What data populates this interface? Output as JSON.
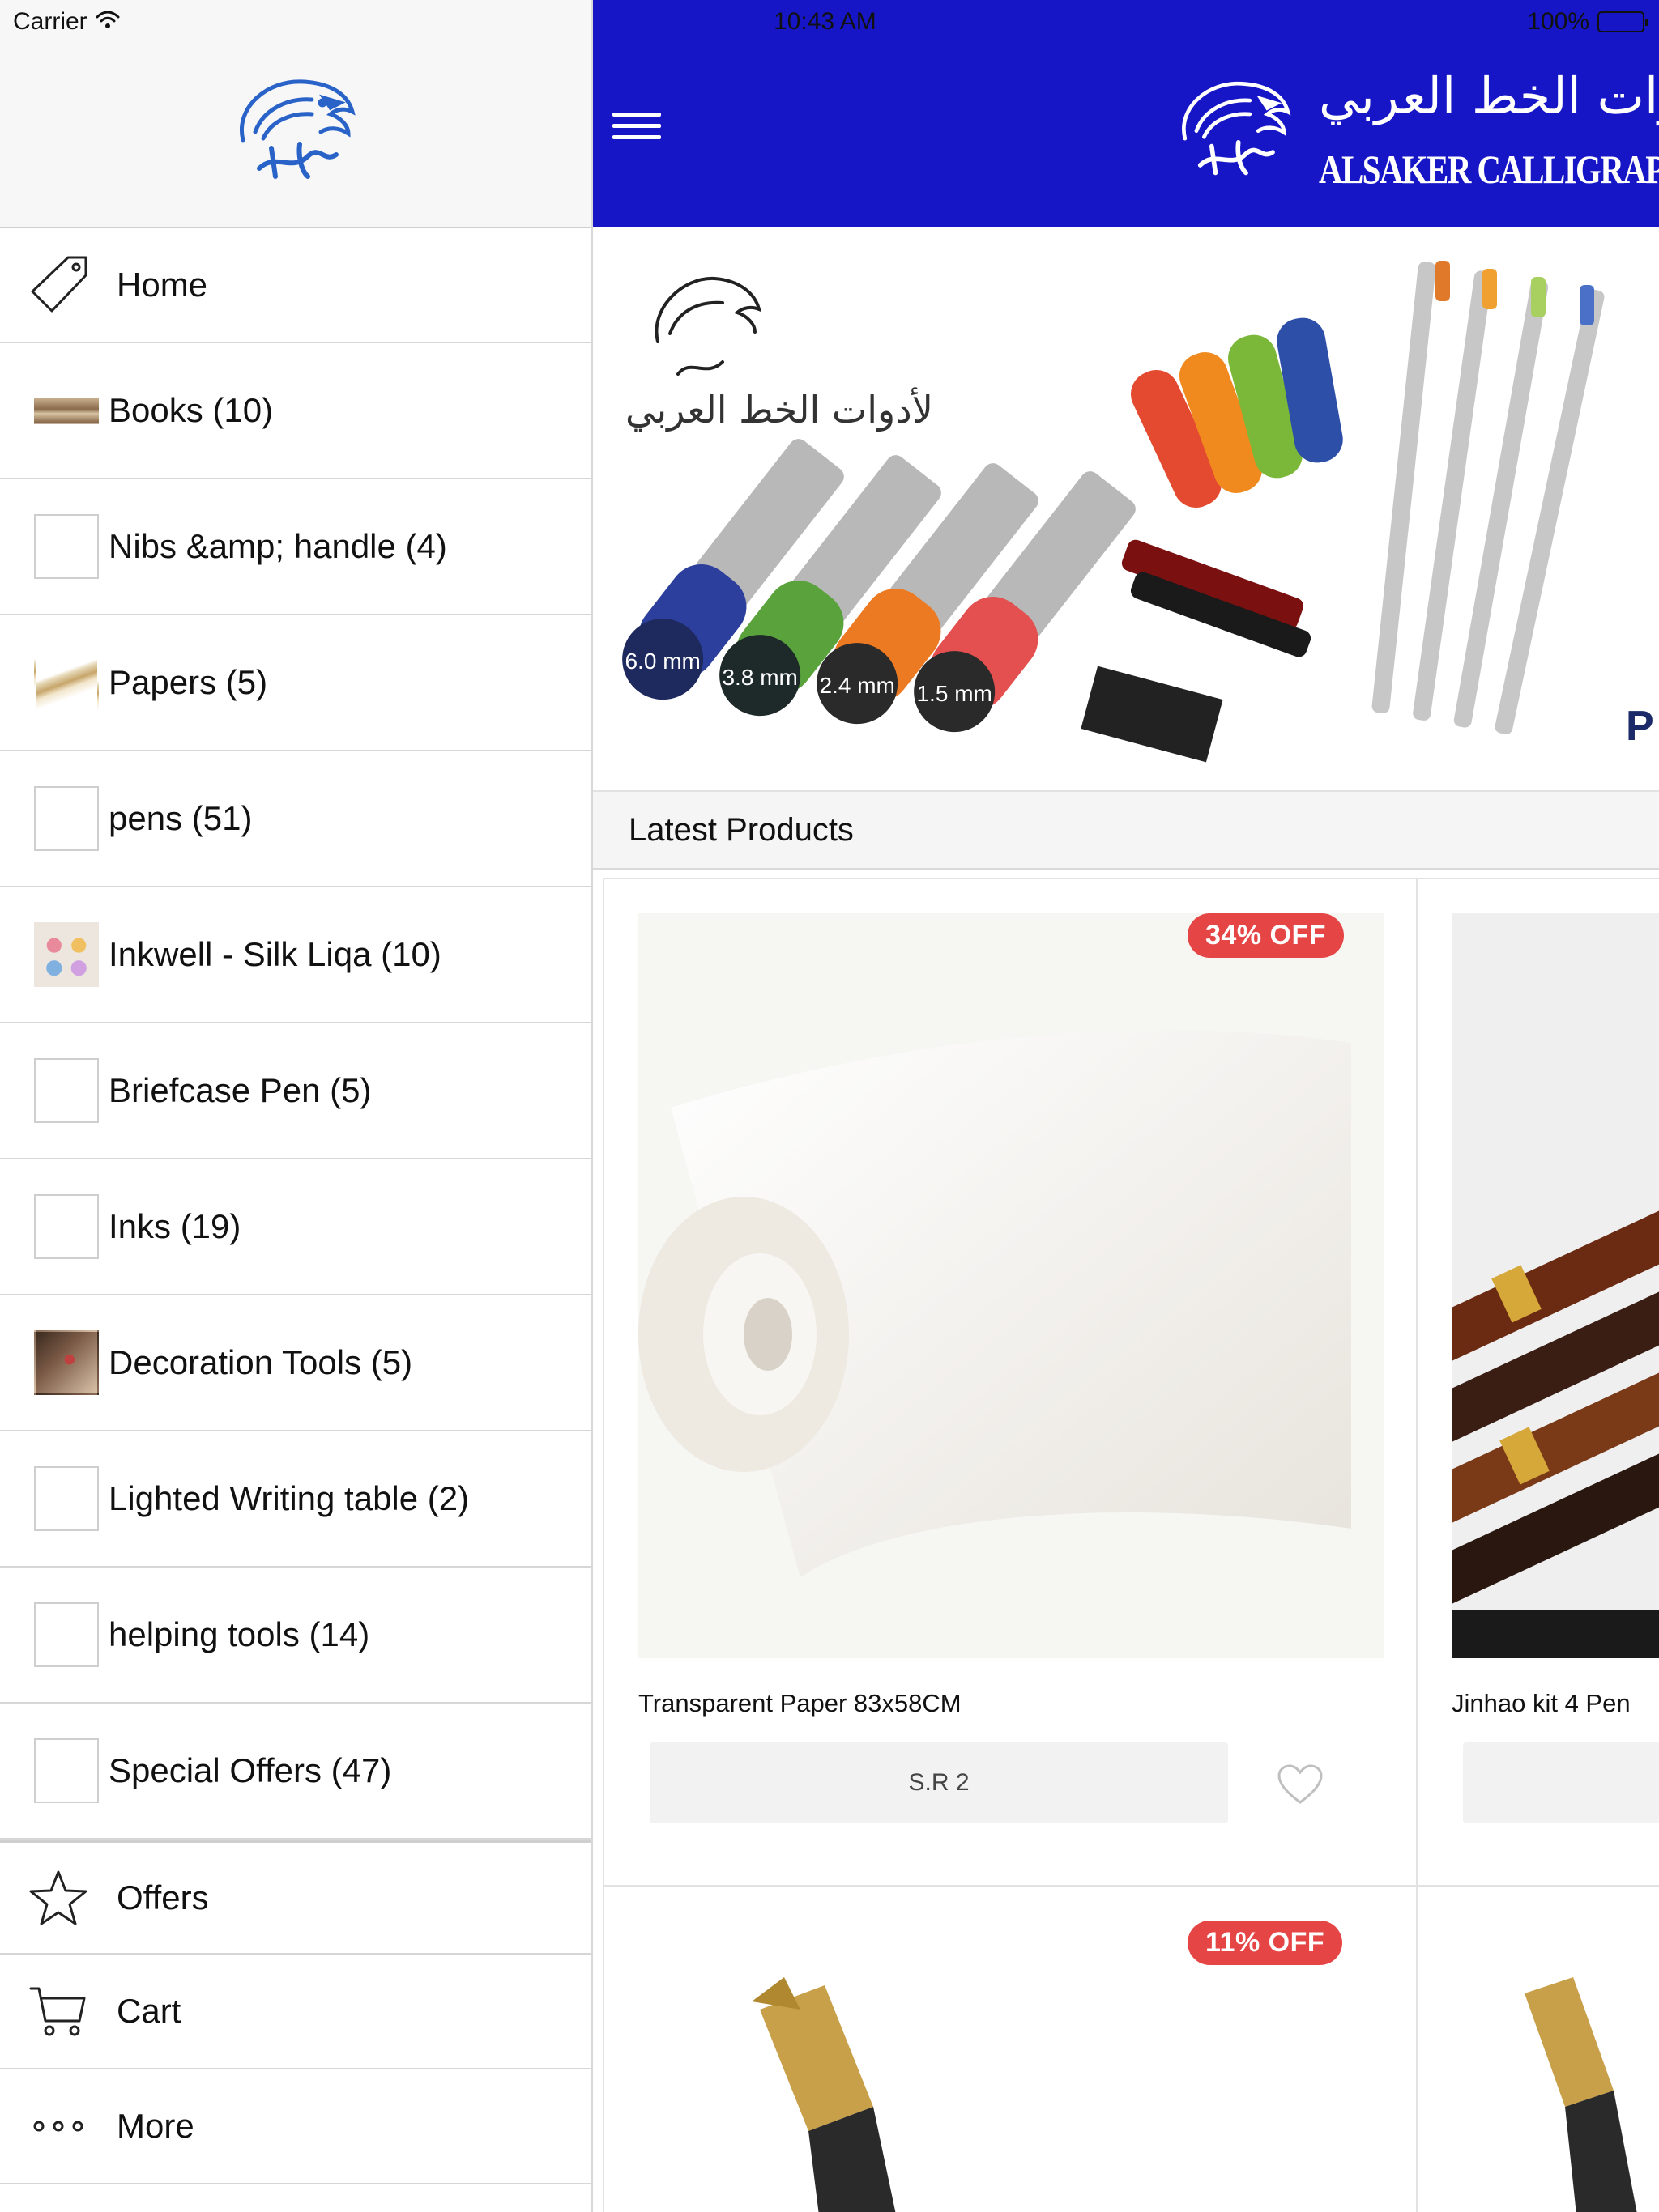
{
  "status_bar": {
    "carrier": "Carrier",
    "time": "10:43 AM",
    "battery": "100%",
    "wifi_icon": "wifi-icon",
    "battery_icon": "battery-icon"
  },
  "sidebar": {
    "logo_icon": "falcon-logo-icon",
    "main_items": [
      {
        "label": "Home",
        "icon": "tag-icon"
      }
    ],
    "categories": [
      {
        "label": "Books (10)"
      },
      {
        "label": "Nibs &amp; handle (4)"
      },
      {
        "label": "Papers (5)"
      },
      {
        "label": "pens (51)"
      },
      {
        "label": "Inkwell - Silk Liqa (10)"
      },
      {
        "label": "Briefcase Pen (5)"
      },
      {
        "label": "Inks (19)"
      },
      {
        "label": "Decoration Tools (5)"
      },
      {
        "label": "Lighted Writing table (2)"
      },
      {
        "label": "helping tools (14)"
      },
      {
        "label": "Special Offers (47)"
      }
    ],
    "bottom_items": [
      {
        "label": "Offers",
        "icon": "star-icon"
      },
      {
        "label": "Cart",
        "icon": "cart-icon"
      },
      {
        "label": "More",
        "icon": "more-dots-icon"
      }
    ]
  },
  "navbar": {
    "menu_icon": "hamburger-icon",
    "brand_arabic": "الصقر لأدوات الخط العربي",
    "brand_text": "ALSAKER CALLIGRAPHY TOOLS",
    "background": "#1616c6"
  },
  "banner": {
    "logo_arabic": "لأدوات الخط العربي",
    "pen_labels": [
      "6.0 mm",
      "3.8 mm",
      "2.4 mm",
      "1.5 mm"
    ],
    "edge_text": "P"
  },
  "latest": {
    "title": "Latest Products",
    "products": [
      {
        "title": "Transparent Paper 83x58CM",
        "discount": "34% OFF",
        "price": "S.R 2"
      },
      {
        "title": "Jinhao kit 4 Pen",
        "discount": "",
        "price": ""
      },
      {
        "title": "",
        "discount": "11% OFF",
        "price": ""
      },
      {
        "title": "",
        "discount": "",
        "price": ""
      }
    ]
  },
  "colors": {
    "navbar": "#1616c6",
    "discount_badge": "#e64545",
    "sidebar_header": "#f7f7f7"
  }
}
